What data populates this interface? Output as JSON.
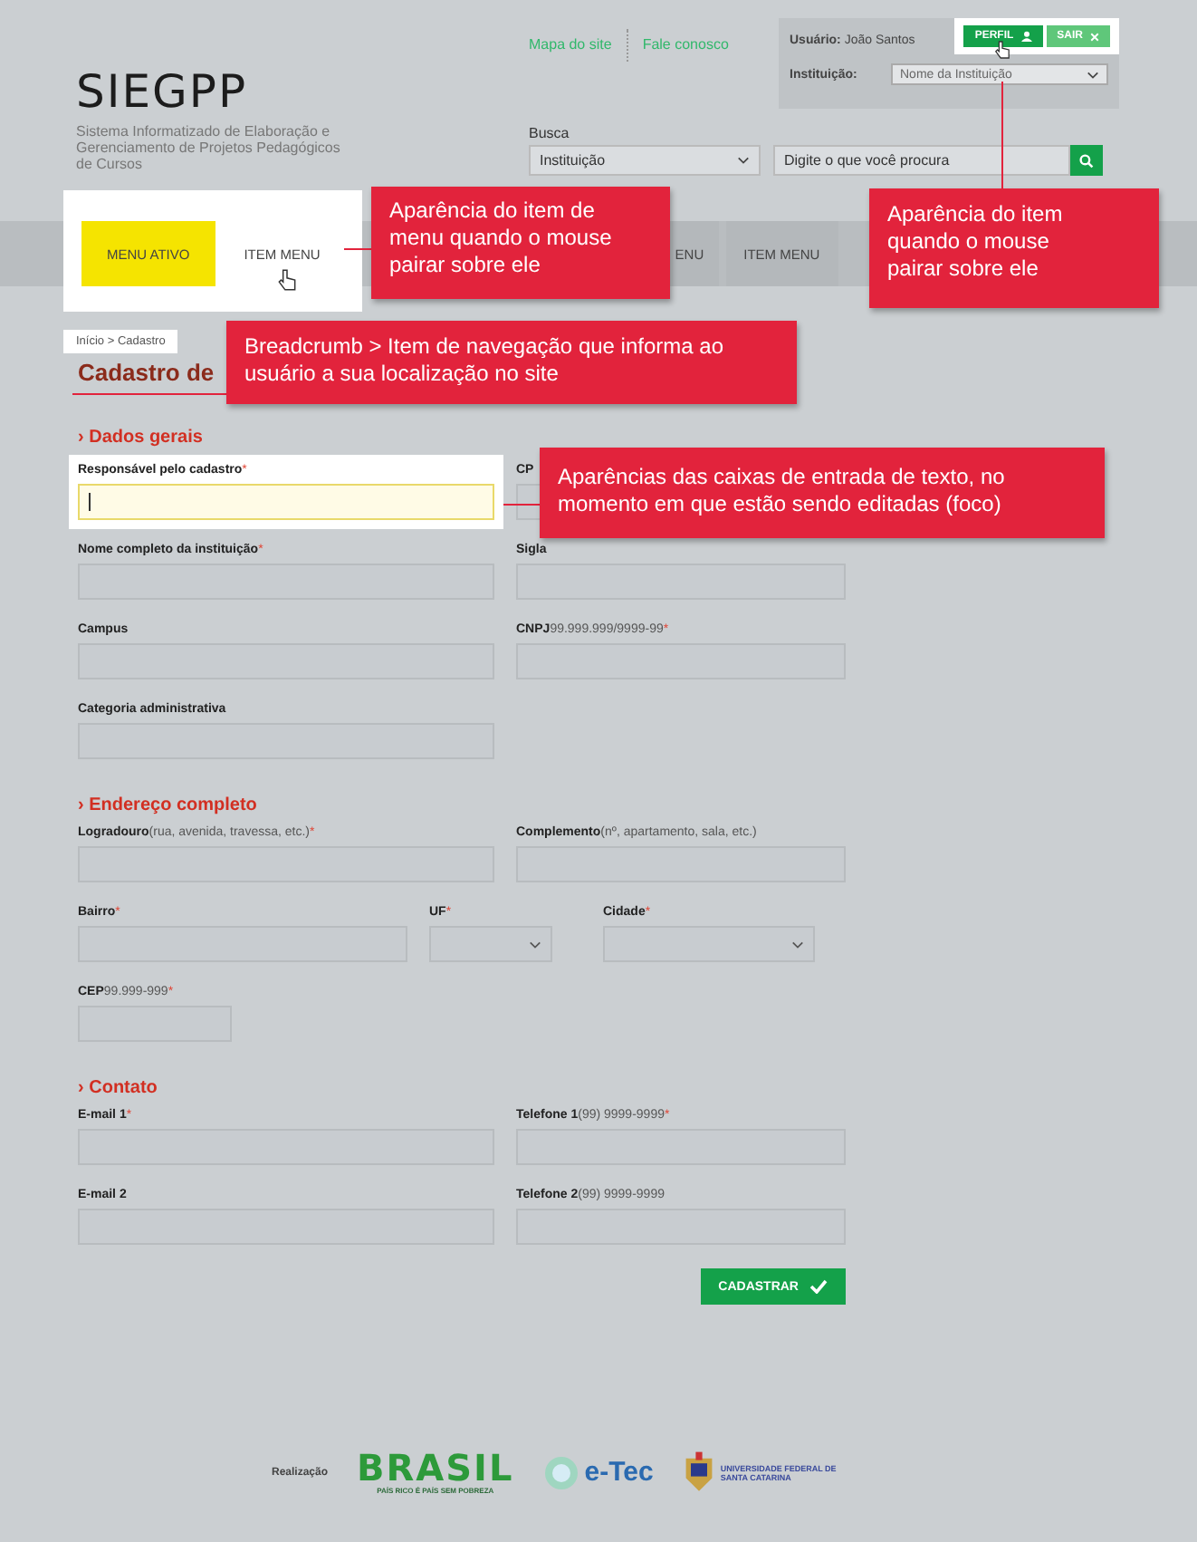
{
  "header": {
    "logo": "SIEGPP",
    "subtitle": "Sistema Informatizado de Elaboração e Gerenciamento de Projetos Pedagógicos de Cursos",
    "top_links": [
      "Mapa do site",
      "Fale conosco"
    ],
    "user": {
      "label": "Usuário:",
      "name": "João Santos"
    },
    "user_buttons": [
      {
        "label": "PERFIL",
        "kind": "profile",
        "hovered": true
      },
      {
        "label": "SAIR",
        "kind": "logout",
        "hovered": false
      }
    ],
    "institution": {
      "label": "Instituição:",
      "value": "Nome da Instituição"
    },
    "search": {
      "label": "Busca",
      "scope": "Instituição",
      "placeholder": "Digite o que você procura"
    }
  },
  "menu": [
    {
      "label": "MENU ATIVO",
      "selected": true,
      "hovered": false
    },
    {
      "label": "ITEM MENU",
      "selected": false,
      "hovered": true
    },
    {
      "label": "ENU",
      "selected": false,
      "hovered": false
    },
    {
      "label": "ITEM MENU",
      "selected": false,
      "hovered": false
    }
  ],
  "breadcrumb": "Início > Cadastro",
  "page_title": "Cadastro de",
  "sections": [
    {
      "marker": "›",
      "title": "Dados gerais",
      "rows": [
        {
          "kind": "pair",
          "fields": [
            {
              "kind": "text",
              "label": "Responsável pelo cadastro",
              "mark": "*",
              "focused": true
            },
            {
              "kind": "text",
              "label": "CP",
              "focused": false
            }
          ]
        },
        {
          "kind": "pair",
          "fields": [
            {
              "kind": "text",
              "label": "Nome completo da instituição",
              "mark": "*",
              "focused": false
            },
            {
              "kind": "text",
              "label": "Sigla",
              "focused": false
            }
          ]
        },
        {
          "kind": "pair",
          "fields": [
            {
              "kind": "text",
              "label": "Campus",
              "focused": false
            },
            {
              "kind": "text",
              "label": "CNPJ",
              "hint": "99.999.999/9999-99",
              "mark": "*",
              "focused": false
            }
          ]
        },
        {
          "kind": "single",
          "fields": [
            {
              "kind": "text",
              "label": "Categoria administrativa",
              "focused": false
            }
          ]
        }
      ]
    },
    {
      "marker": "›",
      "title": "Endereço completo",
      "rows": [
        {
          "kind": "pair",
          "fields": [
            {
              "kind": "text",
              "label": "Logradouro",
              "hint": "(rua, avenida, travessa, etc.)",
              "mark": "*",
              "focused": false
            },
            {
              "kind": "text",
              "label": "Complemento",
              "hint": "(nº, apartamento, sala, etc.)",
              "focused": false
            }
          ]
        },
        {
          "kind": "triple",
          "fields": [
            {
              "kind": "text",
              "label": "Bairro",
              "mark": "*",
              "focused": false
            },
            {
              "kind": "select",
              "label": "UF",
              "mark": "*",
              "focused": false
            },
            {
              "kind": "select",
              "label": "Cidade",
              "mark": "*",
              "focused": false
            }
          ]
        },
        {
          "kind": "short",
          "fields": [
            {
              "kind": "short-text",
              "label": "CEP",
              "hint": "99.999-999",
              "mark": "*",
              "focused": false
            }
          ]
        }
      ]
    },
    {
      "marker": "›",
      "title": "Contato",
      "rows": [
        {
          "kind": "pair",
          "fields": [
            {
              "kind": "text",
              "label": "E-mail 1",
              "mark": "*",
              "focused": false
            },
            {
              "kind": "text",
              "label": "Telefone 1",
              "hint": "(99) 9999-9999",
              "mark": "*",
              "focused": false
            }
          ]
        },
        {
          "kind": "pair",
          "fields": [
            {
              "kind": "text",
              "label": "E-mail 2",
              "focused": false
            },
            {
              "kind": "text",
              "label": "Telefone 2",
              "hint": "(99) 9999-9999",
              "focused": false
            }
          ]
        }
      ]
    }
  ],
  "submit": "CADASTRAR",
  "footer": {
    "label": "Realização",
    "logos": [
      {
        "kind": "brasil",
        "text": "BRASIL",
        "subtext": "PAÍS RICO É PAÍS SEM POBREZA"
      },
      {
        "kind": "etec",
        "text": "e-Tec"
      },
      {
        "kind": "ufsc",
        "text": "UNIVERSIDADE FEDERAL DE SANTA CATARINA"
      }
    ]
  },
  "callouts": [
    {
      "kind": "menu-hover",
      "text": "Aparência do item de menu  quando o mouse pairar sobre ele"
    },
    {
      "kind": "button-hover",
      "text": "Aparência do item quando o mouse pairar sobre ele"
    },
    {
      "kind": "breadcrumb",
      "text": "Breadcrumb > Item de navegação que informa ao usuário a sua localização no site"
    },
    {
      "kind": "input-focus",
      "text": "Aparências das caixas de entrada de texto, no momento em que estão sendo editadas (foco)"
    }
  ]
}
